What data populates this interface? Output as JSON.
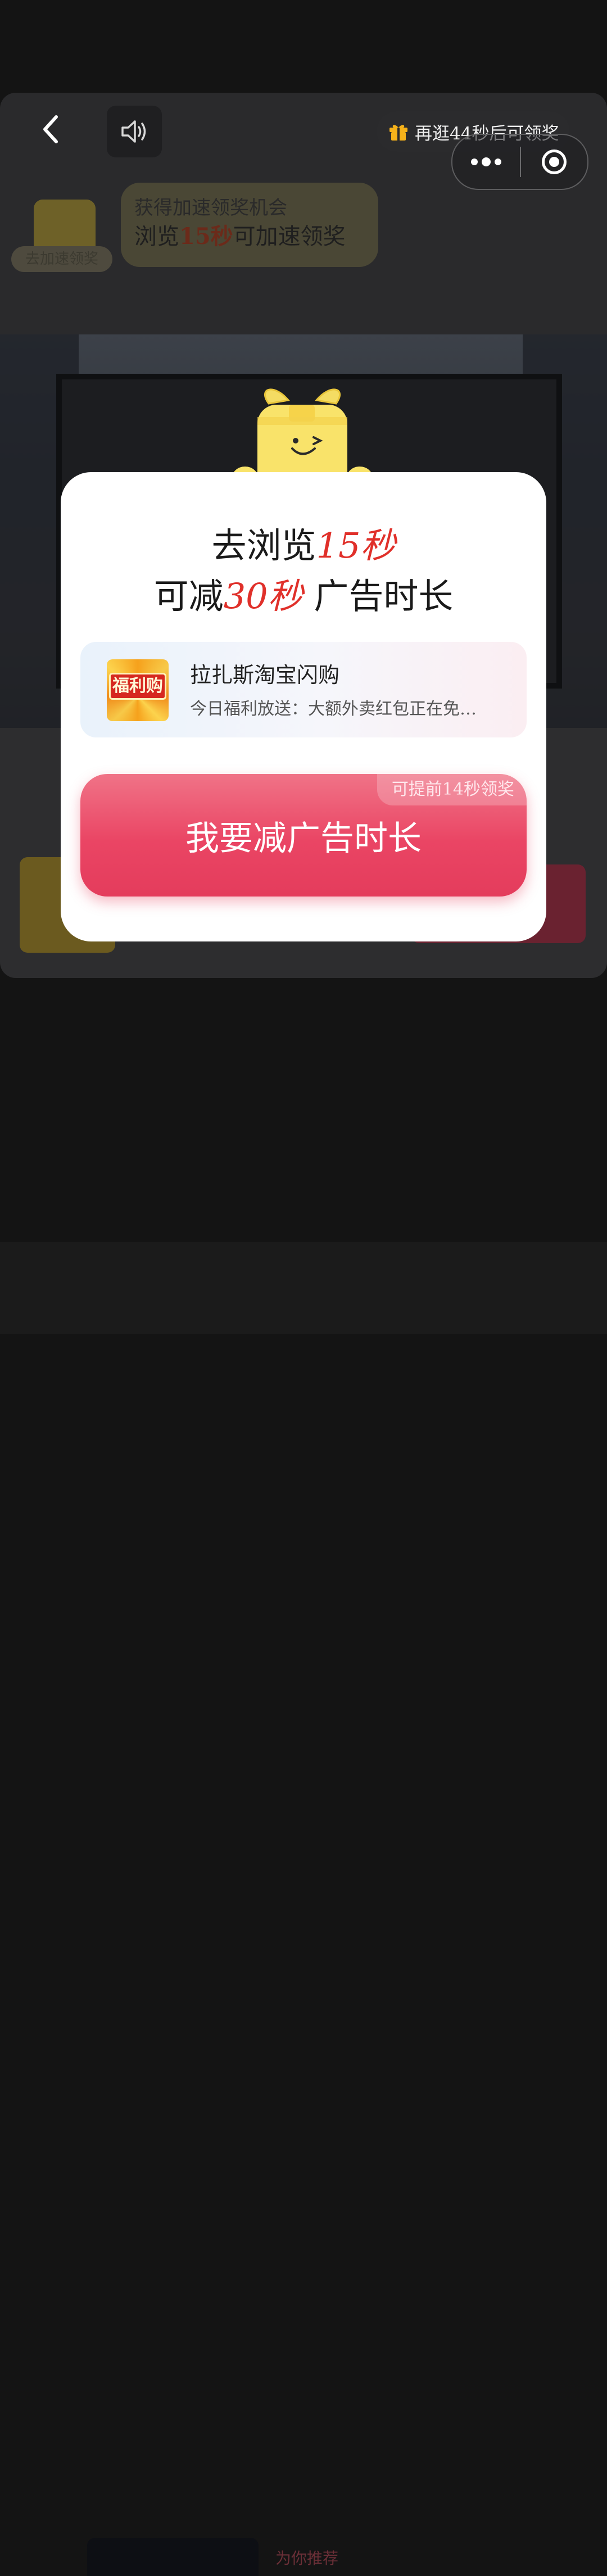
{
  "top_bar": {
    "timer_text": "再逛44秒后可领奖"
  },
  "speed_up": {
    "mascot_label": "去加速领奖",
    "line1": "获得加速领奖机会",
    "line2_prefix": "浏览",
    "line2_highlight": "15秒",
    "line2_suffix": "可加速领奖"
  },
  "modal": {
    "title_line1_prefix": "去浏览",
    "title_line1_highlight": "15秒",
    "title_line2_prefix": "可减",
    "title_line2_highlight": "30秒",
    "title_line2_suffix": "广告时长",
    "app": {
      "icon_text": "福利购",
      "name": "拉扎斯淘宝闪购",
      "description": "今日福利放送：大额外卖红包正在免费领取"
    },
    "cta": {
      "label": "我要减广告时长",
      "tag": "可提前14秒领奖"
    }
  },
  "background": {
    "bottom_chip": "为你推荐"
  },
  "colors": {
    "accent_red": "#e0302a",
    "cta_pink": "#ea4564",
    "modal_bg": "#ffffff"
  }
}
